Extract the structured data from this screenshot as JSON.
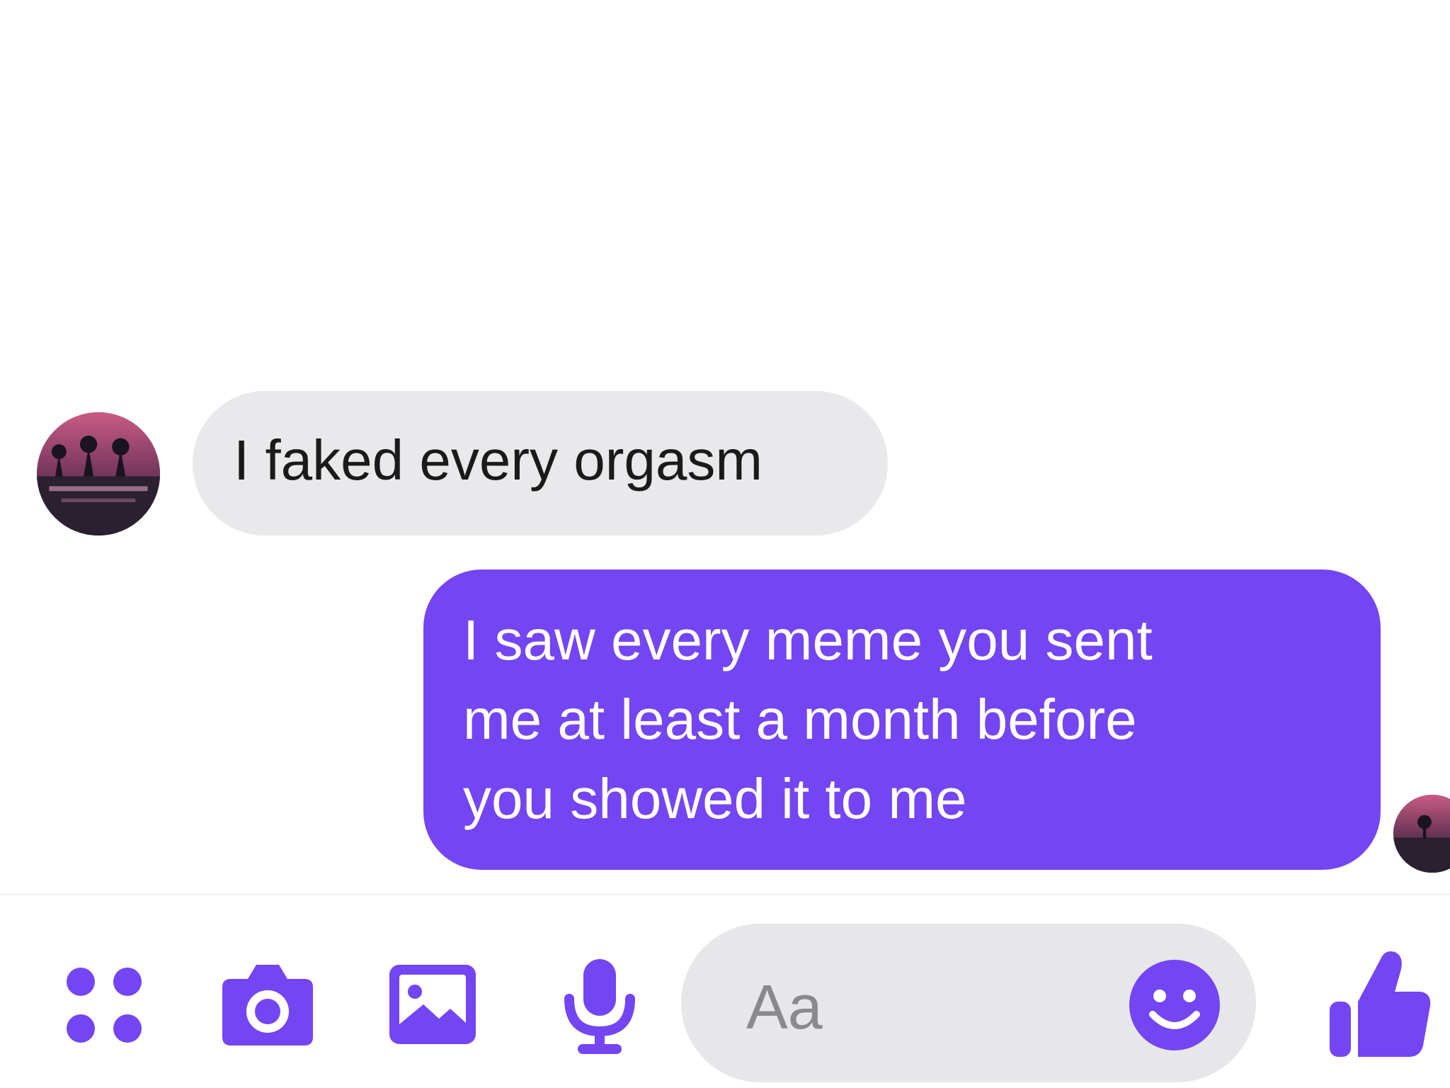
{
  "messages": {
    "received": {
      "text": "I faked every orgasm",
      "avatar_icon": "contact-avatar"
    },
    "sent": {
      "lines": [
        "I saw every meme you sent",
        "me at least a month before",
        "you showed it to me"
      ],
      "seen_icon": "seen-avatar"
    }
  },
  "composer": {
    "placeholder": "Aa",
    "icons": [
      "more-actions-icon",
      "camera-icon",
      "gallery-icon",
      "microphone-icon",
      "emoji-icon",
      "like-icon"
    ]
  },
  "colors": {
    "accent": "#7445f2",
    "received_bubble": "#e9e9eb",
    "input_background": "#e7e7ea",
    "background": "#ffffff"
  }
}
